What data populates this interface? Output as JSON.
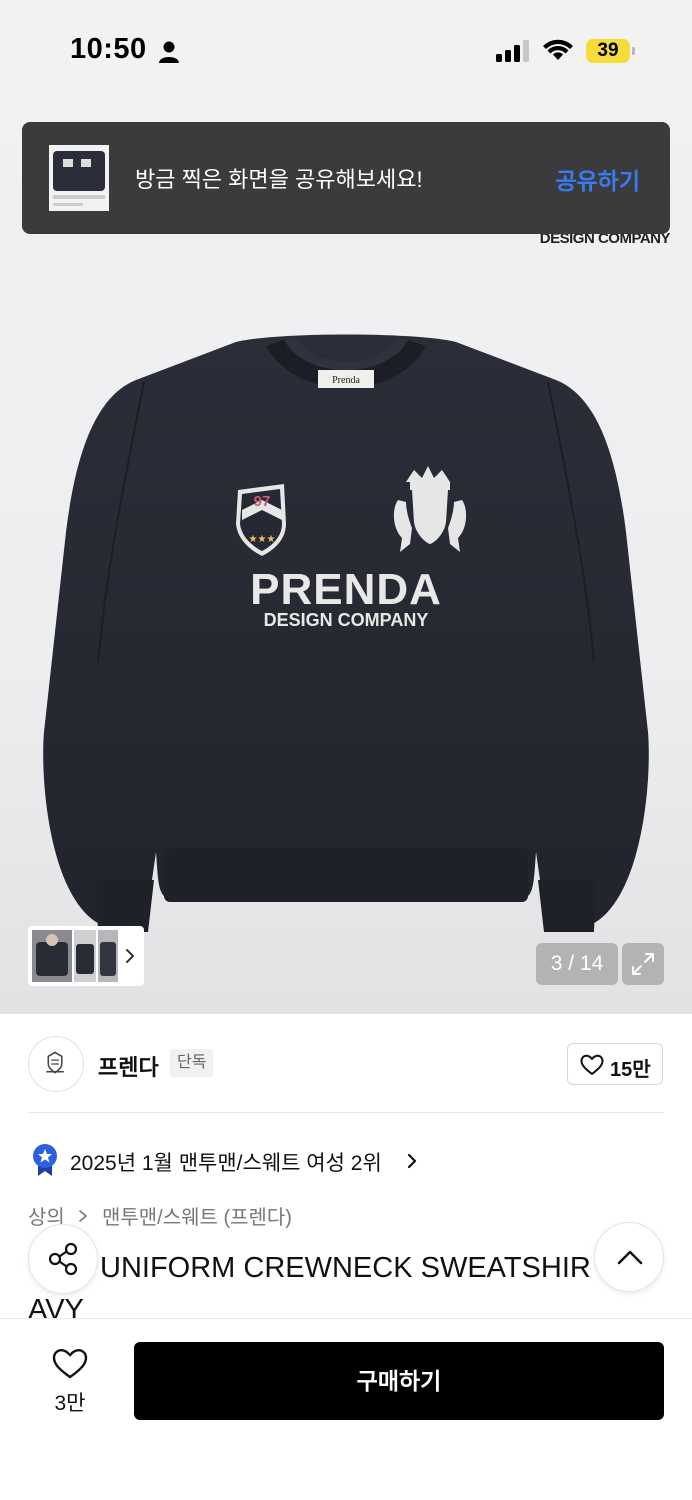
{
  "status_bar": {
    "time": "10:50",
    "battery": "39",
    "icons": [
      "person-icon",
      "signal-icon",
      "wifi-icon",
      "battery-icon"
    ]
  },
  "toast": {
    "message": "방금 찍은 화면을 공유해보세요!",
    "action": "공유하기"
  },
  "gallery": {
    "brand_crop_text": "DESIGN COMPANY",
    "print_brand": "PRENDA",
    "print_sub": "DESIGN COMPANY",
    "print_number": "97",
    "label_tag": "Prenda",
    "counter": "3 / 14"
  },
  "brand": {
    "name": "프렌다",
    "badge": "단독",
    "likes": "15만"
  },
  "ranking": {
    "text": "2025년 1월 맨투맨/스웨트 여성 2위"
  },
  "breadcrumb": {
    "level1": "상의",
    "level2": "맨투맨/스웨트 (프렌다)"
  },
  "product": {
    "title_line1": "UNIFORM CREWNECK SWEATSHIR",
    "title_line2": "AVY"
  },
  "bottom_bar": {
    "wish_count": "3만",
    "buy_label": "구매하기"
  },
  "colors": {
    "toast_bg": "#3b3b3d",
    "toast_action": "#3a7cf0",
    "battery": "#f5dc3b",
    "buy_button": "#000000",
    "rank_badge": "#2d5fe0",
    "sweatshirt": "#262833"
  }
}
